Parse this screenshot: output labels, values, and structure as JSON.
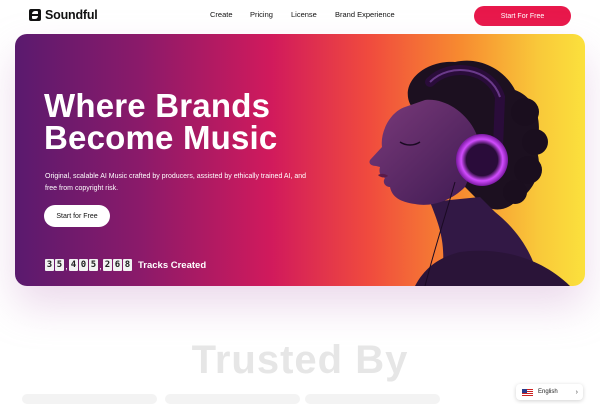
{
  "brand": {
    "name": "Soundful"
  },
  "nav": {
    "links": [
      "Create",
      "Pricing",
      "License",
      "Brand Experience"
    ],
    "cta": "Start For Free"
  },
  "hero": {
    "title_line1": "Where Brands",
    "title_line2": "Become Music",
    "subtitle": "Original, scalable AI Music crafted by producers, assisted by ethically trained AI, and free from copyright risk.",
    "button": "Start for Free",
    "counter_digits": [
      "3",
      "5",
      "4",
      "0",
      "5",
      "2",
      "6",
      "8"
    ],
    "counter_label": "Tracks Created"
  },
  "trusted": {
    "heading": "Trusted By"
  },
  "language": {
    "label": "English",
    "flag": "us-flag-icon",
    "chevron": "›"
  },
  "colors": {
    "accent": "#e8184b",
    "gradient_start": "#5a1a6e",
    "gradient_end": "#fbe13c"
  }
}
